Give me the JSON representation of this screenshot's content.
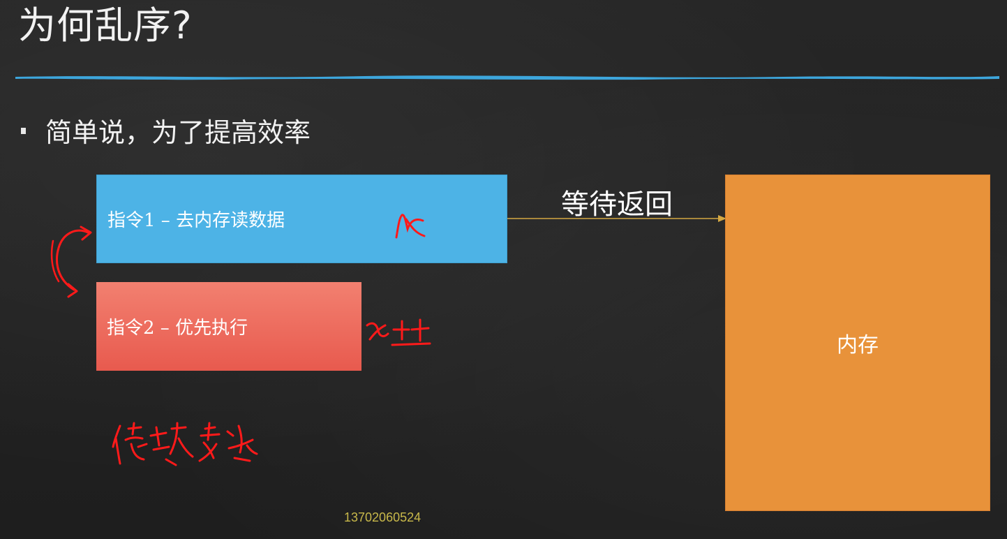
{
  "slide": {
    "title": "为何乱序?",
    "bullet": "简单说，为了提高效率"
  },
  "diagram": {
    "instruction_1": "指令1 – 去内存读数据",
    "instruction_2": "指令2 – 优先执行",
    "arrow_label": "等待返回",
    "memory_label": "内存"
  },
  "footer": {
    "phone": "13702060524"
  },
  "colors": {
    "title_rule": "#3da6dc",
    "instruction_1_fill": "#4db3e6",
    "instruction_2_fill": "#ec6a5c",
    "memory_fill": "#e8923a",
    "arrow": "#d4a843",
    "annotation_ink": "#ff1a1a"
  },
  "handwriting": {
    "ink_color": "#ff1a1a",
    "marks": [
      "swap-arrow",
      "x-mark",
      "x++ mark",
      "dependency scribble"
    ]
  }
}
